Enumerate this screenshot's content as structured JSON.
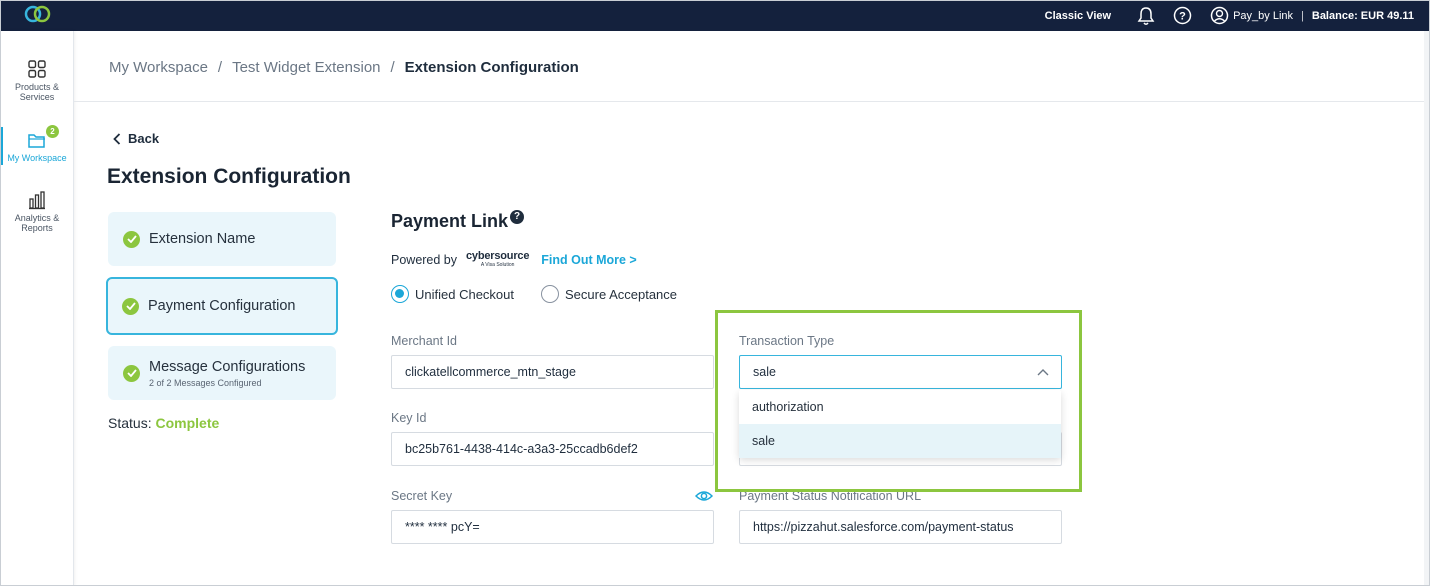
{
  "topbar": {
    "classic_view": "Classic View",
    "account_name": "Pay_by Link",
    "separator": "|",
    "balance_label": "Balance:",
    "balance_value": "EUR 49.11",
    "brand_color": "#14213d"
  },
  "sidebar": {
    "items": [
      {
        "label": "Products & Services",
        "icon": "grid-icon"
      },
      {
        "label": "My Workspace",
        "icon": "folder-icon",
        "badge": "2",
        "active": true
      },
      {
        "label": "Analytics & Reports",
        "icon": "bar-chart-icon"
      }
    ]
  },
  "breadcrumb": {
    "items": [
      "My Workspace",
      "Test Widget Extension",
      "Extension Configuration"
    ],
    "separator": "/"
  },
  "back_label": "Back",
  "page_title": "Extension Configuration",
  "steps": [
    {
      "label": "Extension Name"
    },
    {
      "label": "Payment Configuration",
      "selected": true
    },
    {
      "label": "Message Configurations",
      "sub": "2 of 2 Messages Configured"
    }
  ],
  "status": {
    "label": "Status:",
    "value": "Complete"
  },
  "payment_link": {
    "title": "Payment Link",
    "help": "?",
    "powered_by": "Powered by",
    "provider_word": "cybersource",
    "provider_tagline": "A Visa Solution",
    "find_out_more": "Find Out More >",
    "radios": [
      {
        "label": "Unified Checkout",
        "selected": true
      },
      {
        "label": "Secure Acceptance",
        "selected": false
      }
    ]
  },
  "form": {
    "merchant_id": {
      "label": "Merchant Id",
      "value": "clickatellcommerce_mtn_stage"
    },
    "key_id": {
      "label": "Key Id",
      "value": "bc25b761-4438-414c-a3a3-25ccadb6def2"
    },
    "secret_key": {
      "label": "Secret Key",
      "value": "**** **** pcY="
    },
    "transaction_type": {
      "label": "Transaction Type",
      "value": "sale",
      "options": [
        "authorization",
        "sale"
      ]
    },
    "payment_status_url": {
      "label": "Payment Status Notification URL",
      "value": "https://pizzahut.salesforce.com/payment-status"
    }
  },
  "colors": {
    "accent": "#1ba7d8",
    "success": "#8cc63f",
    "highlight_frame": "#8cc63f"
  }
}
